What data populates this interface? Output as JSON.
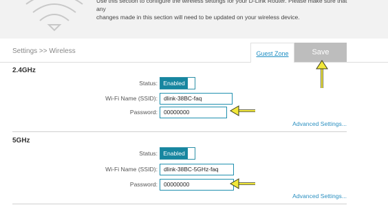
{
  "header": {
    "description_line1": "Use this section to configure the wireless settings for your D-Link Router. Please make sure that any",
    "description_line2": "changes made in this section will need to be updated on your wireless device.",
    "wifi_logo_icon": "wifi-icon"
  },
  "toolbar": {
    "breadcrumb": "Settings >> Wireless",
    "guest_zone_label": "Guest Zone",
    "save_label": "Save"
  },
  "band_24": {
    "title": "2.4GHz",
    "status_label": "Status:",
    "status_value": "Enabled",
    "ssid_label": "Wi-Fi Name (SSID):",
    "ssid_value": "dlink-38BC-faq",
    "password_label": "Password:",
    "password_value": "00000000",
    "advanced_label": "Advanced Settings..."
  },
  "band_5": {
    "title": "5GHz",
    "status_label": "Status:",
    "status_value": "Enabled",
    "ssid_label": "Wi-Fi Name (SSID):",
    "ssid_value": "dlink-38BC-5GHz-faq",
    "password_label": "Password:",
    "password_value": "00000000",
    "advanced_label": "Advanced Settings..."
  },
  "colors": {
    "accent": "#1786a0",
    "annotation_arrow": "#f2e83a",
    "link": "#2a8fc0",
    "save_bg": "#bdbdbd"
  }
}
